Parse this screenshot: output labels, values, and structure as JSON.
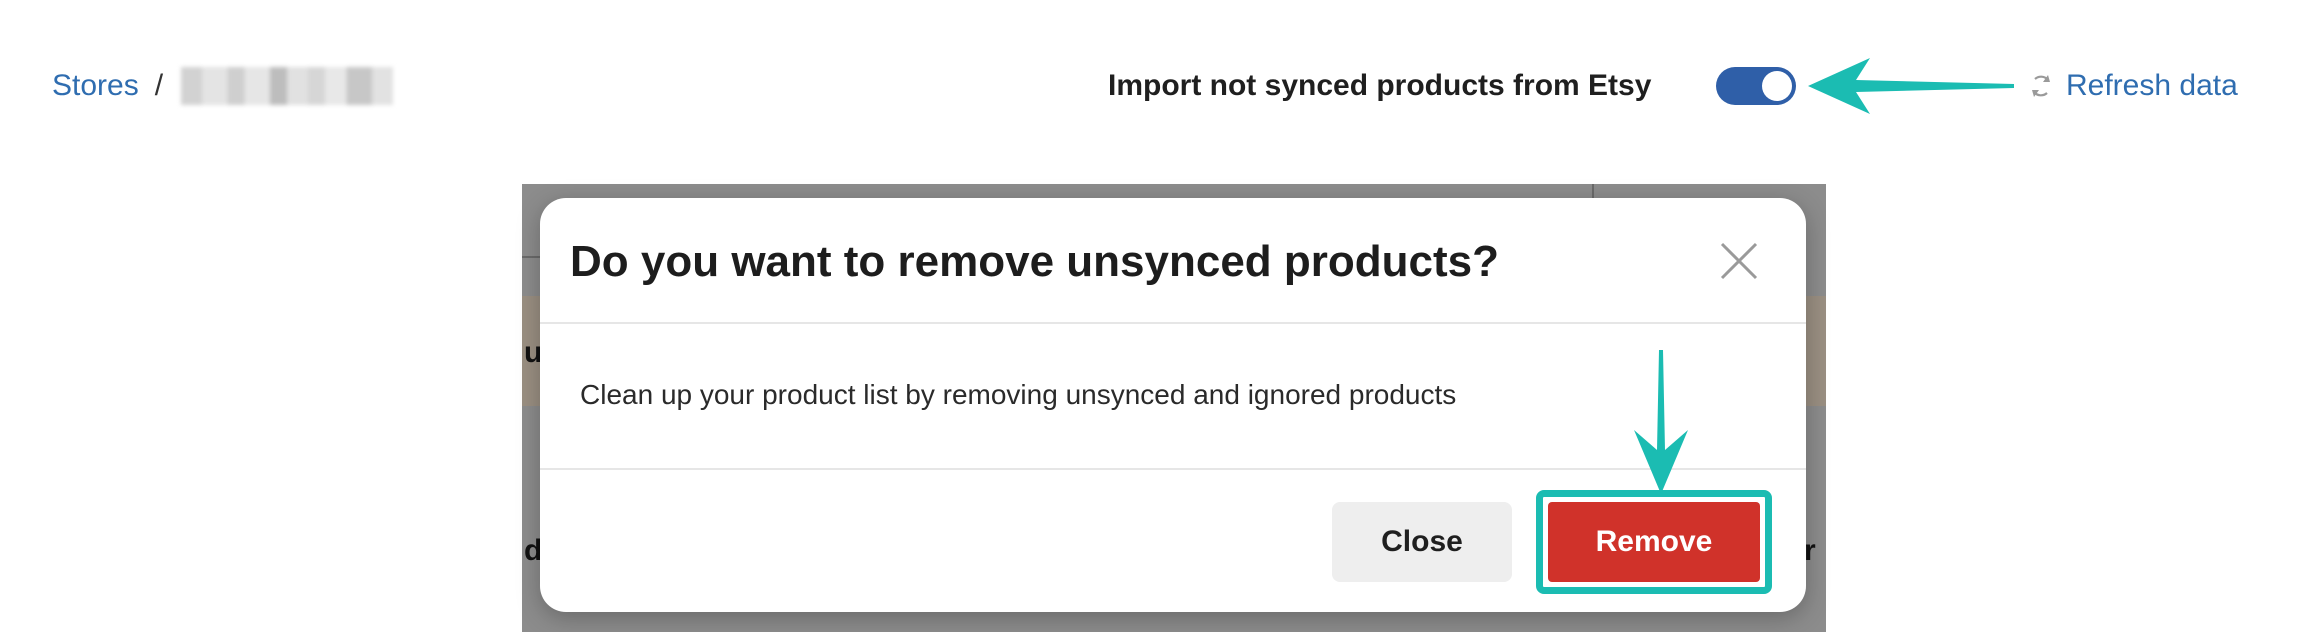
{
  "breadcrumb": {
    "root_label": "Stores",
    "separator": "/"
  },
  "header": {
    "import_label": "Import not synced products from Etsy",
    "import_toggle_on": true,
    "refresh_label": "Refresh data"
  },
  "background_fragments": {
    "left_top": "u",
    "left_bottom": "d",
    "right_bottom": "fr"
  },
  "modal": {
    "title": "Do you want to remove unsynced products?",
    "body": "Clean up your product list by removing unsynced and ignored products",
    "close_label": "Close",
    "remove_label": "Remove"
  },
  "colors": {
    "link": "#2f6db0",
    "toggle_on": "#2f5fa8",
    "annotation_arrow": "#1bbcb2",
    "remove_button": "#d0322a"
  },
  "icons": {
    "refresh": "refresh-icon",
    "close": "close-icon",
    "annotation_left": "arrow-left-icon",
    "annotation_down": "arrow-down-icon"
  }
}
